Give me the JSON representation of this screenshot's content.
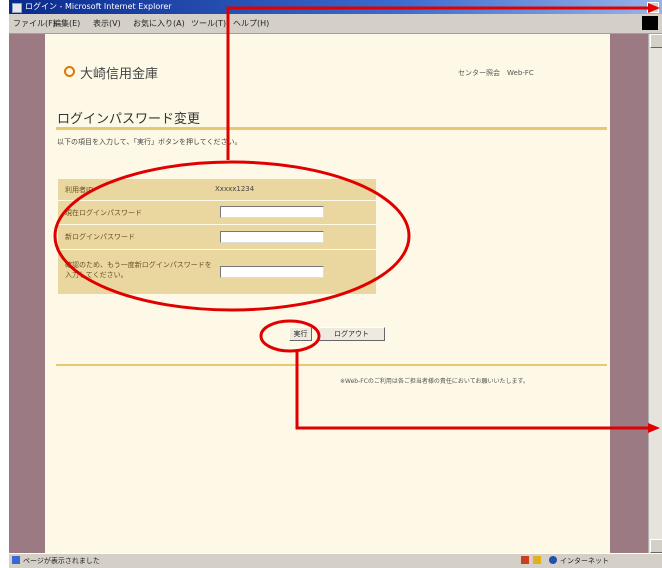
{
  "window": {
    "title": "ログイン - Microsoft Internet Explorer"
  },
  "menu": [
    "ファイル(F)",
    "編集(E)",
    "表示(V)",
    "お気に入り(A)",
    "ツール(T)",
    "ヘルプ(H)"
  ],
  "header": {
    "brand": "大崎信用金庫",
    "top_right": "センター照会　Web-FC"
  },
  "page": {
    "title": "ログインパスワード変更",
    "instruction": "以下の項目を入力して、「実行」ボタンを押してください。"
  },
  "form": {
    "rows": [
      {
        "label": "利用者ID",
        "value": "Xxxxx1234"
      },
      {
        "label": "現在ログインパスワード",
        "value": ""
      },
      {
        "label": "新ログインパスワード",
        "value": ""
      },
      {
        "label": "確認のため、もう一度新ログインパスワードを入力してください。",
        "value": ""
      }
    ]
  },
  "buttons": {
    "execute": "実行",
    "logout": "ログアウト"
  },
  "footer": {
    "note": "※Web-FCのご利用は各ご担当者様の責任においてお願いいたします。"
  },
  "statusbar": {
    "left": "ページが表示されました",
    "zone": "インターネット"
  },
  "colors": {
    "annotation": "#e00000",
    "accent": "#e8c870",
    "form_bg": "#ead7a0",
    "page_bg": "#fdf9e6"
  }
}
